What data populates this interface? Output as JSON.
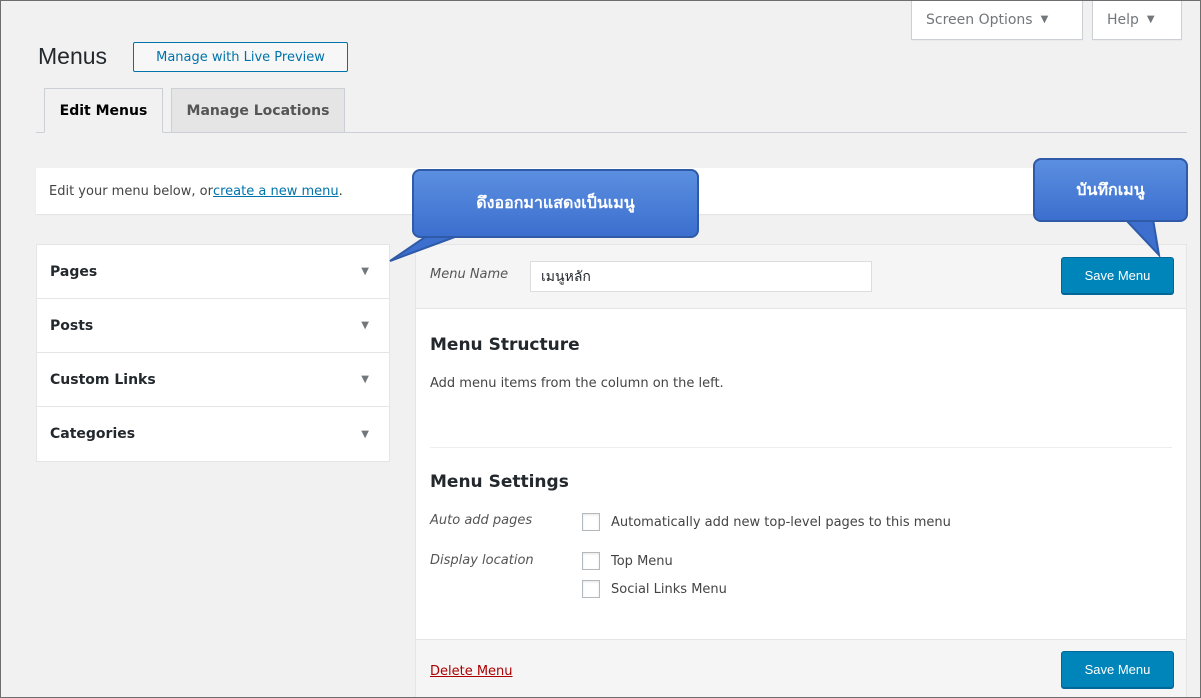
{
  "header": {
    "screen_options": "Screen Options",
    "help": "Help",
    "dropdown_glyph": "▼",
    "page_title": "Menus",
    "live_preview": "Manage with Live Preview"
  },
  "tabs": [
    {
      "label": "Edit Menus",
      "active": true
    },
    {
      "label": "Manage Locations",
      "active": false
    }
  ],
  "notice": {
    "text": "Edit your menu below, or ",
    "link": "create a new menu",
    "end": "."
  },
  "accordion": {
    "items": [
      {
        "label": "Pages"
      },
      {
        "label": "Posts"
      },
      {
        "label": "Custom Links"
      },
      {
        "label": "Categories"
      }
    ],
    "caret": "▼"
  },
  "menu": {
    "name_label": "Menu Name",
    "name_value": "เมนูหลัก",
    "save_label": "Save Menu",
    "structure_title": "Menu Structure",
    "structure_desc": "Add menu items from the column on the left.",
    "settings_title": "Menu Settings",
    "auto_add_label": "Auto add pages",
    "auto_add_option": "Automatically add new top-level pages to this menu",
    "display_label": "Display location",
    "locations": [
      "Top Menu",
      "Social Links Menu"
    ],
    "delete_label": "Delete Menu"
  },
  "callouts": {
    "pull": "ดึงออกมาแสดงเป็นเมนู",
    "save": "บันทึกเมนู"
  },
  "colors": {
    "primary": "#0085ba",
    "link": "#0073aa",
    "delete": "#aa0000",
    "callout": "#4a7fd8"
  }
}
